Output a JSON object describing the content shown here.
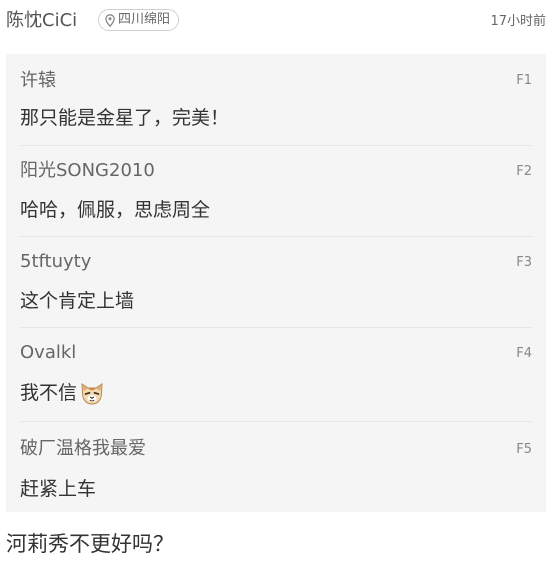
{
  "header": {
    "author": "陈忱CiCi",
    "location": "四川绵阳",
    "location_icon": "pin-icon",
    "time": "17小时前"
  },
  "replies": [
    {
      "user": "许辕",
      "floor": "F1",
      "text": "那只能是金星了，完美！"
    },
    {
      "user": "阳光SONG2010",
      "floor": "F2",
      "text": "哈哈，佩服，思虑周全"
    },
    {
      "user": "5tftuyty",
      "floor": "F3",
      "text": "这个肯定上墙"
    },
    {
      "user": "Ovalkl",
      "floor": "F4",
      "text": "我不信",
      "emoji": "cat-face-icon"
    },
    {
      "user": "破厂温格我最爱",
      "floor": "F5",
      "text": "赶紧上车"
    }
  ],
  "post": {
    "text": "河莉秀不更好吗？"
  },
  "colors": {
    "reply_bg": "#f5f5f5",
    "divider": "#e6e6e6",
    "meta_text": "#666666"
  }
}
